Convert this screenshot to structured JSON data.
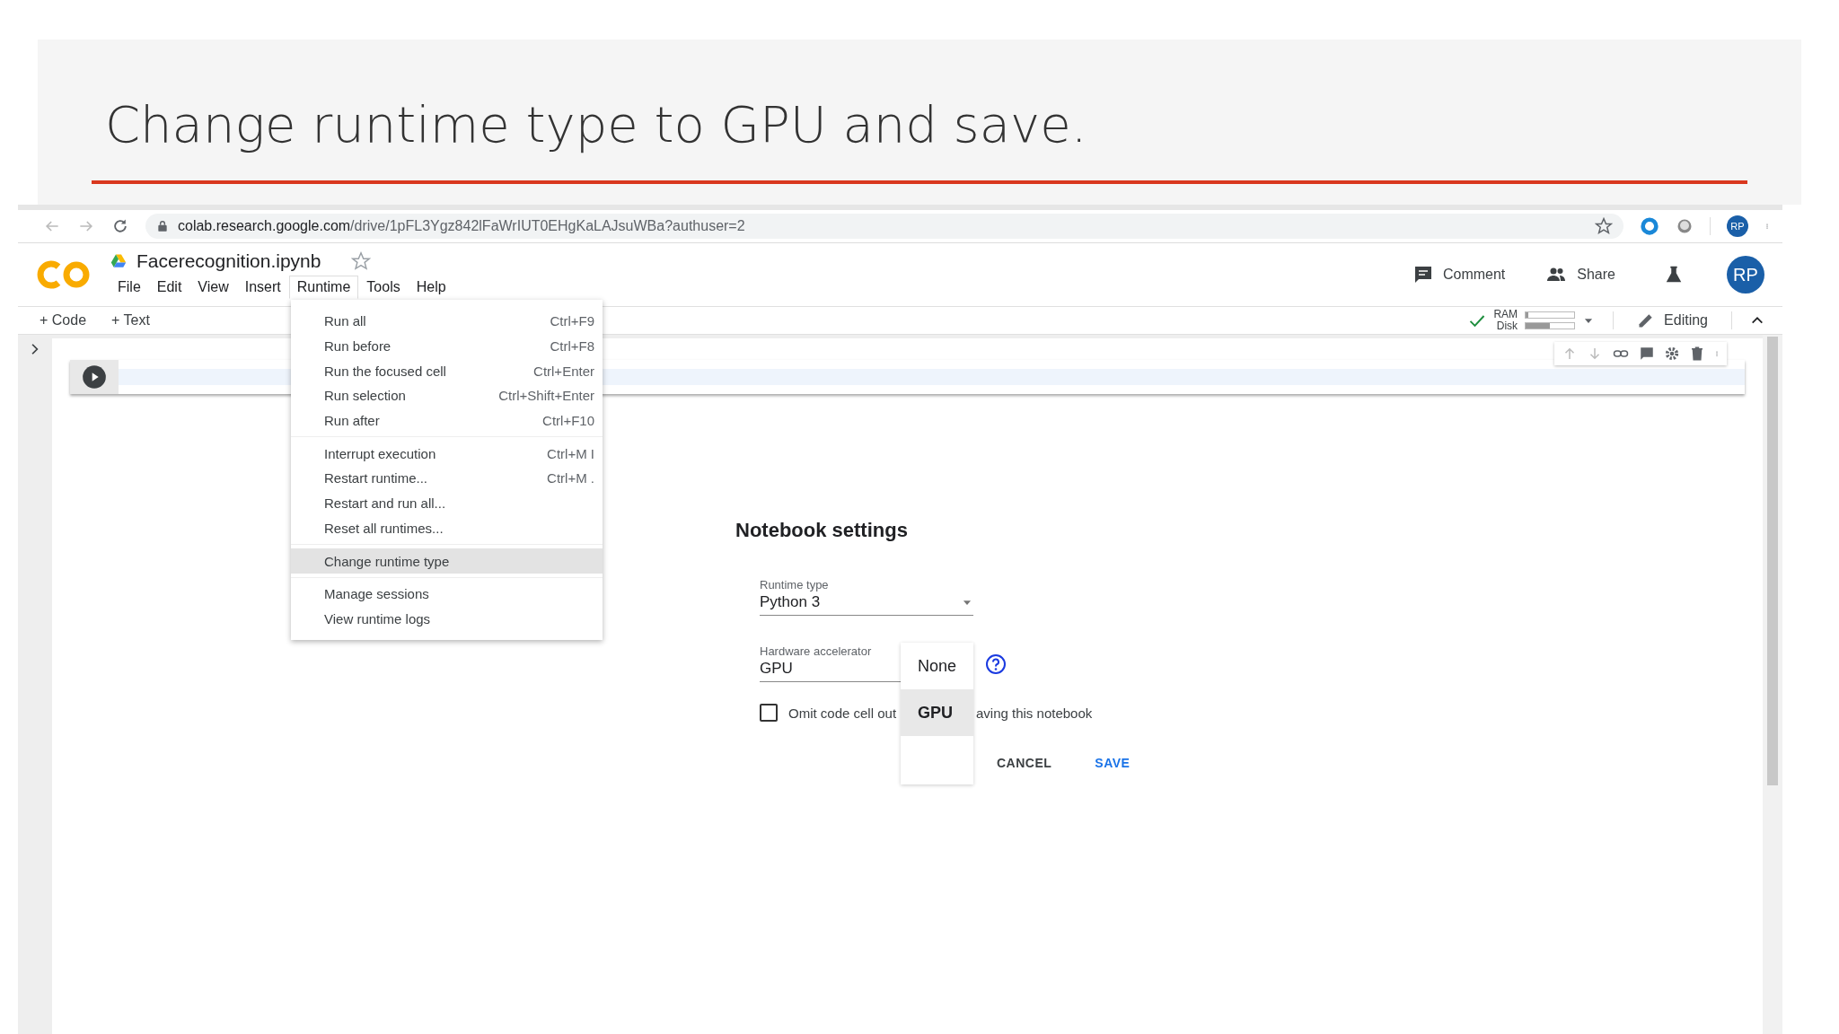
{
  "slide": {
    "title": "Change runtime type to GPU and save."
  },
  "browser": {
    "url_host": "colab.research.google.com",
    "url_path": "/drive/1pFL3Ygz842lFaWrIUT0EHgKaLAJsuWBa?authuser=2",
    "avatar": "RP"
  },
  "colab": {
    "notebook_title": "Facerecognition.ipynb",
    "menu": [
      {
        "label": "File",
        "selected": false
      },
      {
        "label": "Edit",
        "selected": false
      },
      {
        "label": "View",
        "selected": false
      },
      {
        "label": "Insert",
        "selected": false
      },
      {
        "label": "Runtime",
        "selected": true
      },
      {
        "label": "Tools",
        "selected": false
      },
      {
        "label": "Help",
        "selected": false
      }
    ],
    "header_buttons": [
      {
        "label": "Comment",
        "kind": "comment"
      },
      {
        "label": "Share",
        "kind": "share"
      }
    ],
    "avatar": "RP",
    "toolbar": [
      "+ Code",
      "+ Text"
    ],
    "resources": [
      {
        "label": "RAM",
        "level": 0.05
      },
      {
        "label": "Disk",
        "level": 0.5
      }
    ],
    "editing": "Editing"
  },
  "runtime_menu": [
    [
      {
        "label": "Run all",
        "shortcut": "Ctrl+F9",
        "selected": false
      },
      {
        "label": "Run before",
        "shortcut": "Ctrl+F8",
        "selected": false
      },
      {
        "label": "Run the focused cell",
        "shortcut": "Ctrl+Enter",
        "selected": false
      },
      {
        "label": "Run selection",
        "shortcut": "Ctrl+Shift+Enter",
        "selected": false
      },
      {
        "label": "Run after",
        "shortcut": "Ctrl+F10",
        "selected": false
      }
    ],
    [
      {
        "label": "Interrupt execution",
        "shortcut": "Ctrl+M I",
        "selected": false
      },
      {
        "label": "Restart runtime...",
        "shortcut": "Ctrl+M .",
        "selected": false
      },
      {
        "label": "Restart and run all...",
        "selected": false
      },
      {
        "label": "Reset all runtimes...",
        "selected": false
      }
    ],
    [
      {
        "label": "Change runtime type",
        "selected": true
      }
    ],
    [
      {
        "label": "Manage sessions",
        "selected": false
      },
      {
        "label": "View runtime logs",
        "selected": false
      }
    ]
  ],
  "dialog": {
    "title": "Notebook settings",
    "runtime_type": {
      "label": "Runtime type",
      "value": "Python 3"
    },
    "hardware_accelerator": {
      "label": "Hardware accelerator",
      "value": "GPU"
    },
    "accelerator_options": [
      {
        "label": "None",
        "selected": false
      },
      {
        "label": "GPU",
        "selected": true
      }
    ],
    "omit_output": {
      "label_start": "Omit code cell out",
      "label_end": "aving this notebook",
      "checked": false
    },
    "buttons": [
      {
        "label": "CANCEL",
        "kind": "secondary"
      },
      {
        "label": "SAVE",
        "kind": "primary"
      }
    ]
  }
}
